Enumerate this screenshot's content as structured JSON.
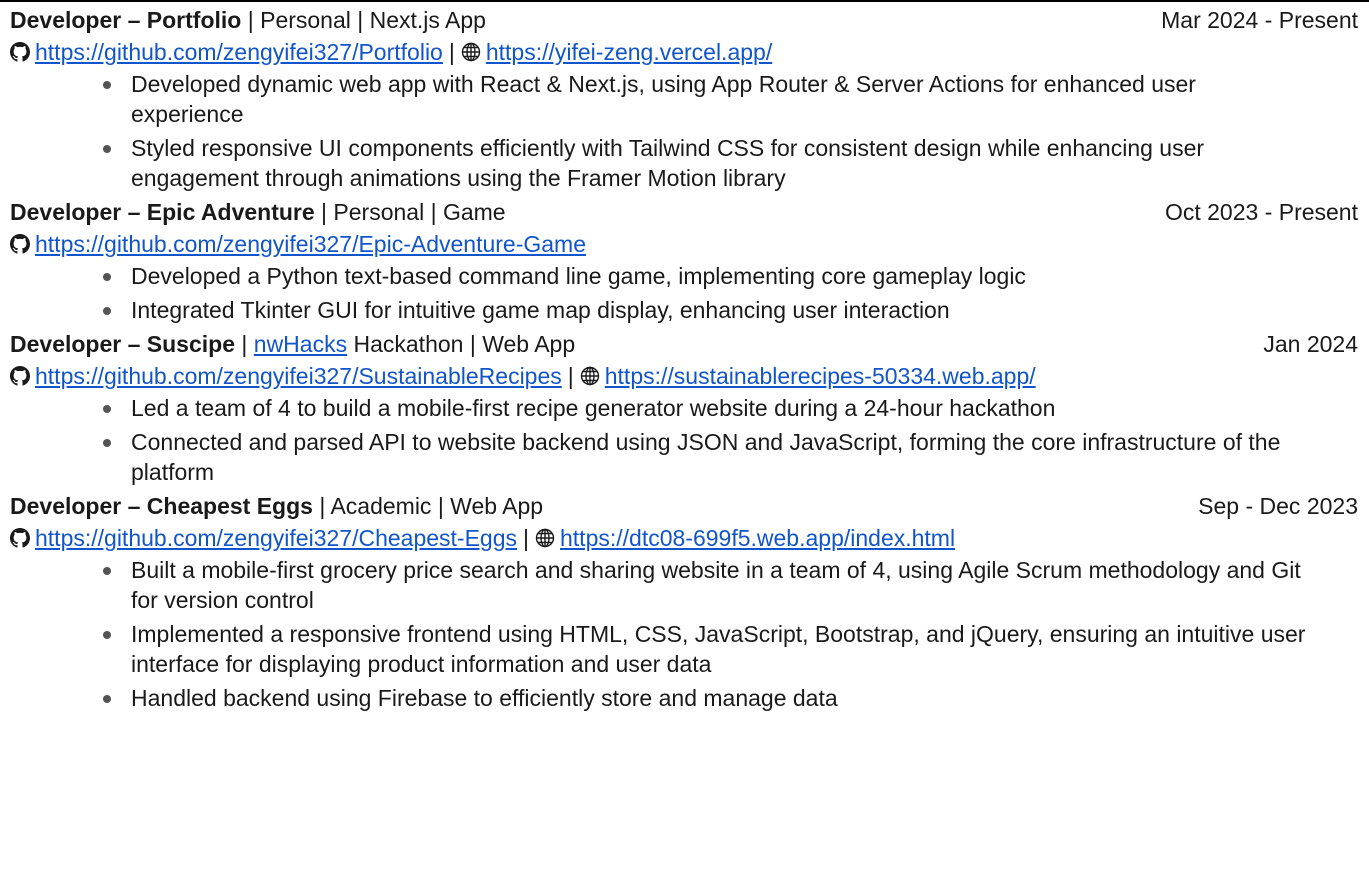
{
  "projects": [
    {
      "role": "Developer –",
      "name": "Portfolio",
      "parts": [
        " | Personal | Next.js App"
      ],
      "date": "Mar 2024 - Present",
      "github_url": "https://github.com/zengyifei327/Portfolio",
      "site_url": "https://yifei-zeng.vercel.app/",
      "bullets": [
        "Developed dynamic web app with React & Next.js, using App Router & Server Actions for enhanced user experience",
        "Styled responsive UI components efficiently with Tailwind CSS for consistent design while enhancing user engagement through animations using the Framer Motion library"
      ]
    },
    {
      "role": "Developer –",
      "name": "Epic Adventure",
      "parts": [
        " | Personal | Game"
      ],
      "date": "Oct 2023 - Present",
      "github_url": "https://github.com/zengyifei327/Epic-Adventure-Game",
      "site_url": null,
      "bullets": [
        "Developed a Python text-based command line game, implementing core gameplay logic",
        "Integrated Tkinter GUI for intuitive game map display, enhancing user interaction"
      ]
    },
    {
      "role": "Developer –",
      "name": "Suscipe",
      "prefix": " | ",
      "event_link": "nwHacks",
      "suffix": " Hackathon | Web App",
      "date": "Jan 2024",
      "github_url": "https://github.com/zengyifei327/SustainableRecipes",
      "site_url": "https://sustainablerecipes-50334.web.app/",
      "bullets": [
        "Led a team of 4 to build a mobile-first recipe generator website during a 24-hour hackathon",
        "Connected and parsed API to website backend using JSON and JavaScript, forming the core infrastructure of the platform"
      ]
    },
    {
      "role": "Developer –",
      "name": "Cheapest Eggs",
      "parts": [
        " | Academic | Web App"
      ],
      "date": "Sep - Dec 2023",
      "github_url": "https://github.com/zengyifei327/Cheapest-Eggs",
      "site_url": "https://dtc08-699f5.web.app/index.html",
      "bullets": [
        "Built a mobile-first grocery price search and sharing website in a team of 4, using Agile Scrum methodology and Git for version control",
        "Implemented a responsive frontend using HTML, CSS, JavaScript, Bootstrap, and jQuery, ensuring an intuitive user interface for displaying product information and user data",
        "Handled backend using Firebase to efficiently store and manage data"
      ]
    }
  ],
  "separator": "|",
  "colors": {
    "link": "#1155cc",
    "text": "#1a1a1a"
  },
  "icons": {
    "repo": "github-icon",
    "site": "globe-icon"
  }
}
